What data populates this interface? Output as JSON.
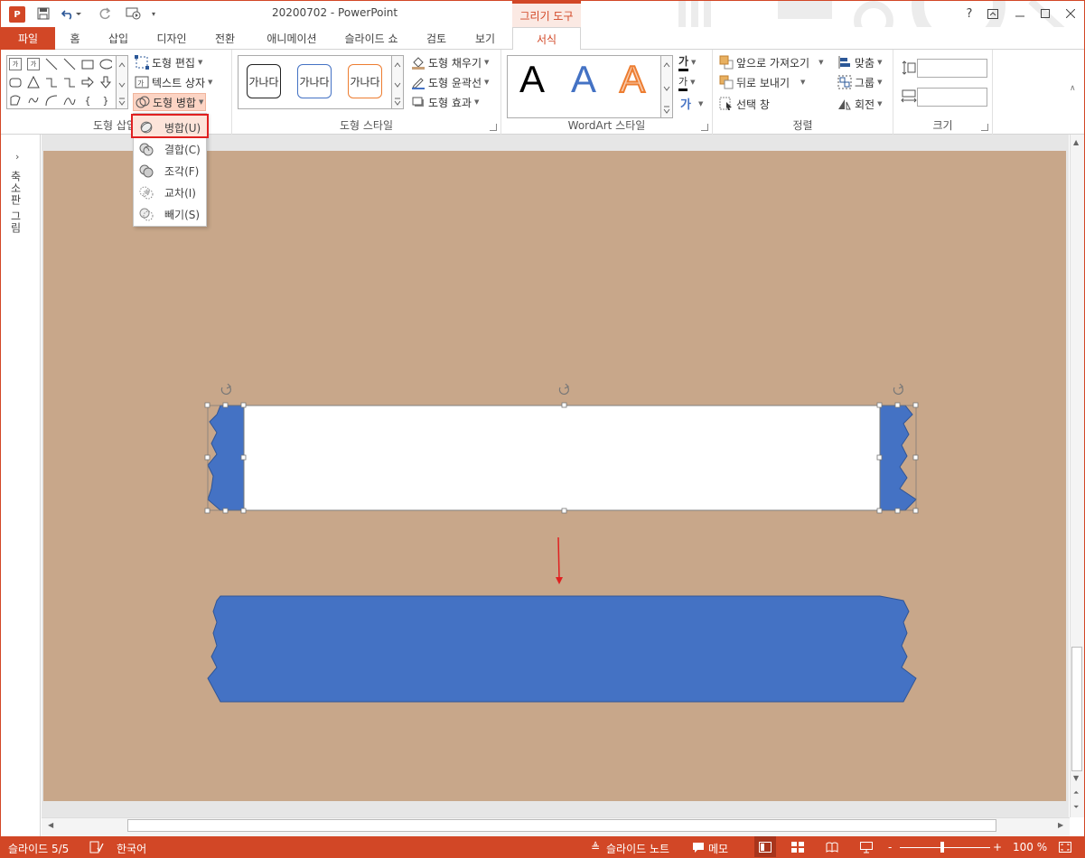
{
  "app": {
    "doc_title": "20200702 - PowerPoint",
    "app_icon_letter": "P",
    "context_tab_group": "그리기 도구",
    "help": "?"
  },
  "tabs": [
    {
      "label": "파일"
    },
    {
      "label": "홈"
    },
    {
      "label": "삽입"
    },
    {
      "label": "디자인"
    },
    {
      "label": "전환"
    },
    {
      "label": "애니메이션"
    },
    {
      "label": "슬라이드 쇼"
    },
    {
      "label": "검토"
    },
    {
      "label": "보기"
    },
    {
      "label": "서식"
    }
  ],
  "ribbon": {
    "insert_shapes": {
      "label": "도형 삽입",
      "edit_shape": "도형 편집",
      "text_box": "텍스트 상자",
      "merge_shapes": "도형 병합"
    },
    "shape_styles": {
      "label": "도형 스타일",
      "samples": [
        "가나다",
        "가나다",
        "가나다"
      ],
      "fill": "도형 채우기",
      "outline": "도형 윤곽선",
      "effects": "도형 효과"
    },
    "wordart": {
      "label": "WordArt 스타일",
      "samples": [
        "A",
        "A",
        "A"
      ],
      "text_fill_glyph": "가",
      "text_outline_glyph": "가"
    },
    "arrange": {
      "label": "정렬",
      "bring_forward": "앞으로 가져오기",
      "send_backward": "뒤로 보내기",
      "selection_pane": "선택 창",
      "align": "맞춤",
      "group": "그룹",
      "rotate": "회전"
    },
    "size": {
      "label": "크기",
      "height_value": "",
      "width_value": ""
    }
  },
  "merge_menu": {
    "items": [
      {
        "label": "병합(U)",
        "icon": "union-icon"
      },
      {
        "label": "결합(C)",
        "icon": "combine-icon"
      },
      {
        "label": "조각(F)",
        "icon": "fragment-icon"
      },
      {
        "label": "교차(I)",
        "icon": "intersect-icon"
      },
      {
        "label": "빼기(S)",
        "icon": "subtract-icon"
      }
    ]
  },
  "left_pane": {
    "label": "축소판 그림"
  },
  "slide": {
    "background_color": "#c8a78a",
    "shape_fill": "#4472c4",
    "white_fill": "#ffffff",
    "arrow_color": "#e02020"
  },
  "status": {
    "slide_indicator": "슬라이드 5/5",
    "language": "한국어",
    "notes": "슬라이드 노트",
    "comments": "메모",
    "zoom": "100 %",
    "zoom_minus": "-",
    "zoom_plus": "+"
  },
  "colors": {
    "accent": "#d24726",
    "highlight": "#fcd4c4"
  }
}
